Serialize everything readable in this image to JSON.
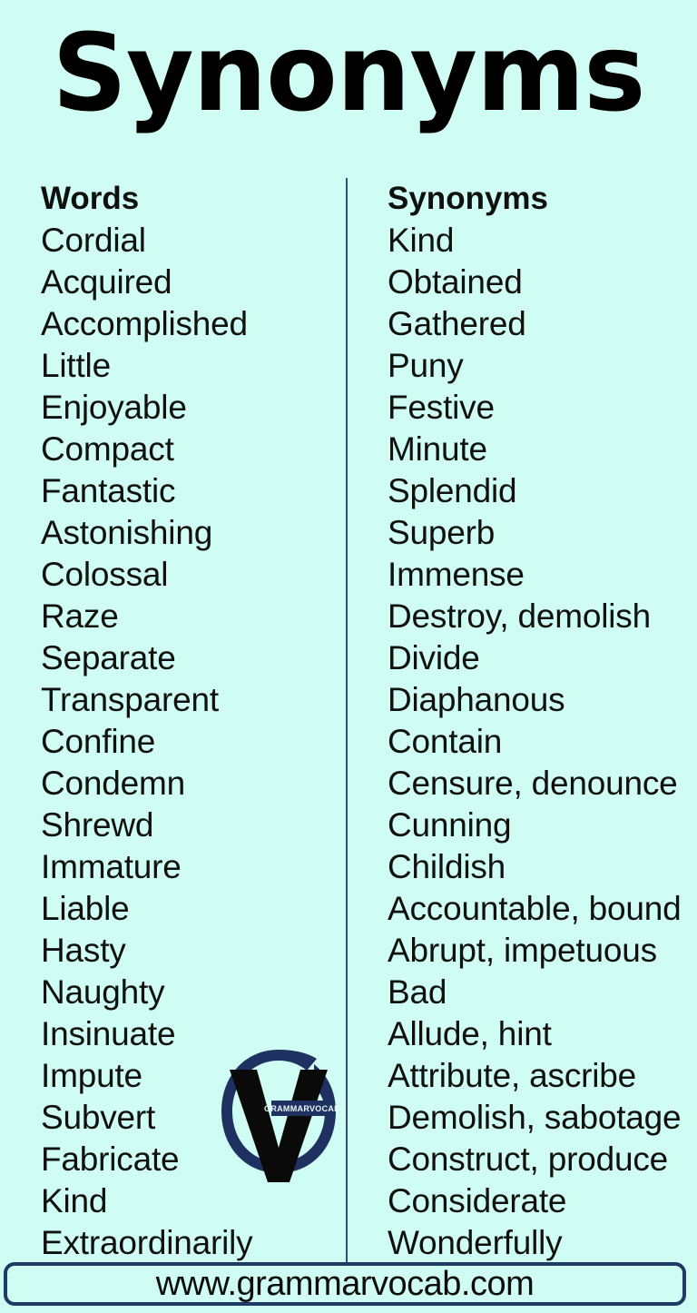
{
  "page": {
    "title": "Synonyms",
    "background_color": "#cffdf3",
    "divider_color": "#2f4f6f",
    "text_color": "#101010"
  },
  "table": {
    "headers": {
      "words": "Words",
      "synonyms": "Synonyms"
    },
    "rows": [
      {
        "word": "Cordial",
        "synonym": "Kind"
      },
      {
        "word": "Acquired",
        "synonym": "Obtained"
      },
      {
        "word": "Accomplished",
        "synonym": "Gathered"
      },
      {
        "word": "Little",
        "synonym": "Puny"
      },
      {
        "word": "Enjoyable",
        "synonym": "Festive"
      },
      {
        "word": "Compact",
        "synonym": "Minute"
      },
      {
        "word": "Fantastic",
        "synonym": "Splendid"
      },
      {
        "word": "Astonishing",
        "synonym": "Superb"
      },
      {
        "word": "Colossal",
        "synonym": "Immense"
      },
      {
        "word": "Raze",
        "synonym": "Destroy, demolish"
      },
      {
        "word": "Separate",
        "synonym": "Divide"
      },
      {
        "word": "Transparent",
        "synonym": "Diaphanous"
      },
      {
        "word": "Confine",
        "synonym": "Contain"
      },
      {
        "word": "Condemn",
        "synonym": "Censure, denounce"
      },
      {
        "word": "Shrewd",
        "synonym": "Cunning"
      },
      {
        "word": "Immature",
        "synonym": "Childish"
      },
      {
        "word": "Liable",
        "synonym": "Accountable, bound"
      },
      {
        "word": "Hasty",
        "synonym": "Abrupt, impetuous"
      },
      {
        "word": "Naughty",
        "synonym": "Bad"
      },
      {
        "word": "Insinuate",
        "synonym": "Allude, hint"
      },
      {
        "word": "Impute",
        "synonym": "Attribute, ascribe"
      },
      {
        "word": "Subvert",
        "synonym": "Demolish, sabotage"
      },
      {
        "word": "Fabricate",
        "synonym": "Construct, produce"
      },
      {
        "word": "Kind",
        "synonym": "Considerate"
      },
      {
        "word": "Extraordinarily",
        "synonym": "Wonderfully"
      }
    ]
  },
  "logo": {
    "banner_text": "GRAMMARVOCAB",
    "ring_color": "#1f3160",
    "mark_color": "#0a0a0a"
  },
  "footer": {
    "url": "www.grammarvocab.com",
    "border_color": "#1f3a63"
  }
}
